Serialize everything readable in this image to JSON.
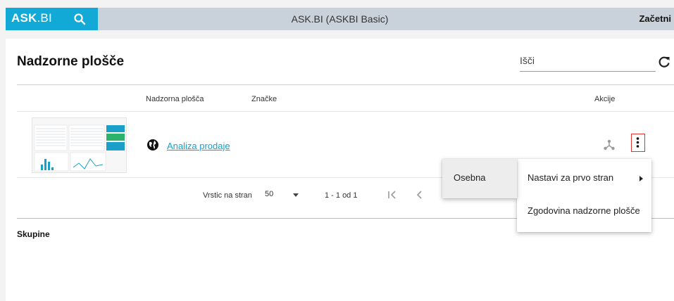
{
  "topbar": {
    "brand_bold": "ASK",
    "brand_light": ".BI",
    "title": "ASK.BI (ASKBI Basic)",
    "start_link": "Začetni"
  },
  "page": {
    "title": "Nadzorne plošče",
    "search_placeholder": "Išči"
  },
  "table": {
    "columns": {
      "dashboard": "Nadzorna plošča",
      "tags": "Značke",
      "actions": "Akcije"
    },
    "rows": [
      {
        "name": "Analiza prodaje"
      }
    ]
  },
  "pagination": {
    "rows_per_page_label": "Vrstic na stran",
    "rows_per_page_value": "50",
    "range_text": "1 - 1 od 1"
  },
  "groups": {
    "title": "Skupine"
  },
  "context_menu": {
    "items": [
      {
        "label": "Nastavi za prvo stran"
      },
      {
        "label": "Zgodovina nadzorne plošče"
      }
    ]
  },
  "sub_menu": {
    "items": [
      {
        "label": "Osebna"
      }
    ]
  },
  "colors": {
    "brand": "#12a9d6",
    "topbar": "#c9d2da",
    "link": "#1aa0c8",
    "highlight": "#e0332e"
  }
}
